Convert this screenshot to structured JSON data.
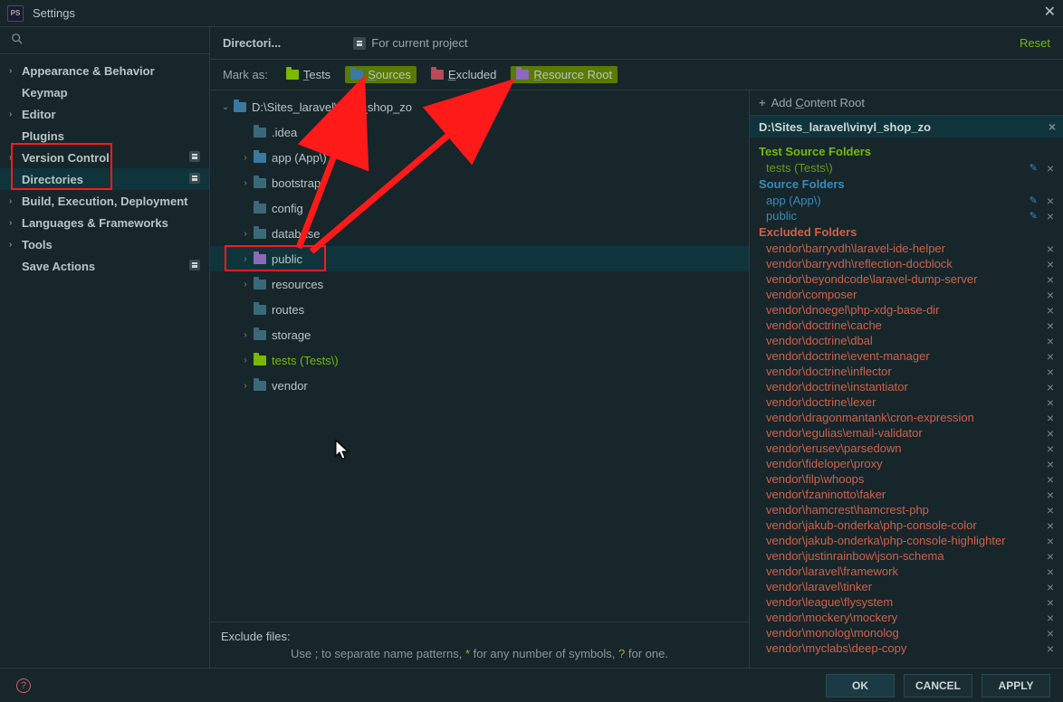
{
  "window": {
    "title": "Settings"
  },
  "header": {
    "breadcrumb": "Directori...",
    "for_project": "For current project",
    "reset": "Reset"
  },
  "sidebar": {
    "items": [
      {
        "label": "Appearance & Behavior",
        "chev": true
      },
      {
        "label": "Keymap"
      },
      {
        "label": "Editor",
        "chev": true
      },
      {
        "label": "Plugins"
      },
      {
        "label": "Version Control",
        "chev": true,
        "gear": true
      },
      {
        "label": "Directories",
        "gear": true,
        "selected": true
      },
      {
        "label": "Build, Execution, Deployment",
        "chev": true
      },
      {
        "label": "Languages & Frameworks",
        "chev": true
      },
      {
        "label": "Tools",
        "chev": true
      },
      {
        "label": "Save Actions",
        "gear": true
      }
    ]
  },
  "mark_as": {
    "label": "Mark as:",
    "tests": "Tests",
    "sources": "Sources",
    "excluded": "Excluded",
    "resource": "Resource Root"
  },
  "tree": [
    {
      "label": "D:\\Sites_laravel\\vinyl_shop_zo",
      "level": 0,
      "open": true,
      "color": "plain"
    },
    {
      "label": ".idea",
      "level": 1,
      "color": "plain2"
    },
    {
      "label": "app (App\\)",
      "level": 1,
      "chev": true,
      "color": "sources"
    },
    {
      "label": "bootstrap",
      "level": 1,
      "chev": true,
      "color": "plain2"
    },
    {
      "label": "config",
      "level": 1,
      "color": "plain2"
    },
    {
      "label": "database",
      "level": 1,
      "chev": true,
      "color": "plain2"
    },
    {
      "label": "public",
      "level": 1,
      "chev": true,
      "color": "resource",
      "selected": true
    },
    {
      "label": "resources",
      "level": 1,
      "chev": true,
      "color": "plain2"
    },
    {
      "label": "routes",
      "level": 1,
      "color": "plain2"
    },
    {
      "label": "storage",
      "level": 1,
      "chev": true,
      "color": "plain2"
    },
    {
      "label": "tests (Tests\\)",
      "level": 1,
      "chev": true,
      "color": "tests",
      "green": true
    },
    {
      "label": "vendor",
      "level": 1,
      "chev": true,
      "color": "plain2"
    }
  ],
  "exclude": {
    "label": "Exclude files:",
    "hint_pre": "Use ; to separate name patterns, ",
    "hint_star": "*",
    "hint_mid": " for any number of symbols, ",
    "hint_q": "?",
    "hint_end": " for one."
  },
  "right": {
    "add_root": "Add Content Root",
    "root_path": "D:\\Sites_laravel\\vinyl_shop_zo",
    "test_h": "Test Source Folders",
    "tests": [
      "tests (Tests\\)"
    ],
    "src_h": "Source Folders",
    "sources": [
      "app (App\\)",
      "public"
    ],
    "exc_h": "Excluded Folders",
    "excluded": [
      "vendor\\barryvdh\\laravel-ide-helper",
      "vendor\\barryvdh\\reflection-docblock",
      "vendor\\beyondcode\\laravel-dump-server",
      "vendor\\composer",
      "vendor\\dnoegel\\php-xdg-base-dir",
      "vendor\\doctrine\\cache",
      "vendor\\doctrine\\dbal",
      "vendor\\doctrine\\event-manager",
      "vendor\\doctrine\\inflector",
      "vendor\\doctrine\\instantiator",
      "vendor\\doctrine\\lexer",
      "vendor\\dragonmantank\\cron-expression",
      "vendor\\egulias\\email-validator",
      "vendor\\erusev\\parsedown",
      "vendor\\fideloper\\proxy",
      "vendor\\filp\\whoops",
      "vendor\\fzaninotto\\faker",
      "vendor\\hamcrest\\hamcrest-php",
      "vendor\\jakub-onderka\\php-console-color",
      "vendor\\jakub-onderka\\php-console-highlighter",
      "vendor\\justinrainbow\\json-schema",
      "vendor\\laravel\\framework",
      "vendor\\laravel\\tinker",
      "vendor\\league\\flysystem",
      "vendor\\mockery\\mockery",
      "vendor\\monolog\\monolog",
      "vendor\\myclabs\\deep-copy"
    ]
  },
  "footer": {
    "ok": "OK",
    "cancel": "CANCEL",
    "apply": "APPLY"
  }
}
